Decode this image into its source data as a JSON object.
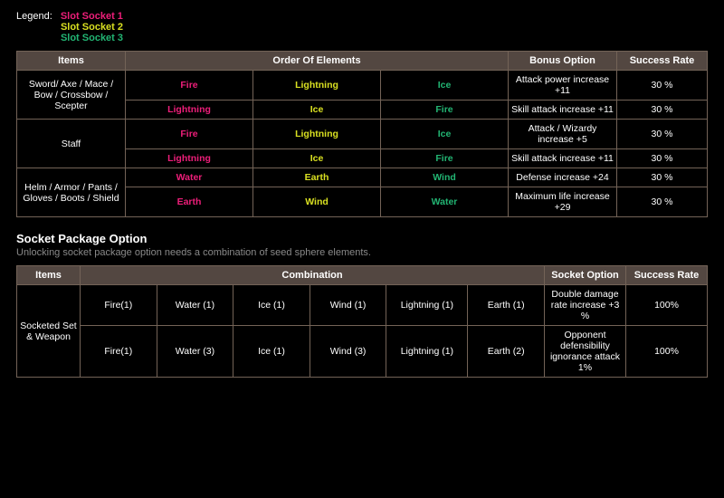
{
  "legend": {
    "label": "Legend:",
    "s1": "Slot Socket 1",
    "s2": "Slot Socket 2",
    "s3": "Slot Socket 3"
  },
  "t1": {
    "h": {
      "items": "Items",
      "order": "Order Of Elements",
      "bonus": "Bonus Option",
      "rate": "Success Rate"
    },
    "g": [
      {
        "item": "Sword/ Axe / Mace / Bow / Crossbow / Scepter",
        "rows": [
          {
            "e1": "Fire",
            "e2": "Lightning",
            "e3": "Ice",
            "bonus": "Attack power increase +11",
            "rate": "30 %"
          },
          {
            "e1": "Lightning",
            "e2": "Ice",
            "e3": "Fire",
            "bonus": "Skill attack increase +11",
            "rate": "30 %"
          }
        ]
      },
      {
        "item": "Staff",
        "rows": [
          {
            "e1": "Fire",
            "e2": "Lightning",
            "e3": "Ice",
            "bonus": "Attack / Wizardy increase +5",
            "rate": "30 %"
          },
          {
            "e1": "Lightning",
            "e2": "Ice",
            "e3": "Fire",
            "bonus": "Skill attack increase +11",
            "rate": "30 %"
          }
        ]
      },
      {
        "item": "Helm / Armor / Pants / Gloves / Boots / Shield",
        "rows": [
          {
            "e1": "Water",
            "e2": "Earth",
            "e3": "Wind",
            "bonus": "Defense increase +24",
            "rate": "30 %"
          },
          {
            "e1": "Earth",
            "e2": "Wind",
            "e3": "Water",
            "bonus": "Maximum life increase +29",
            "rate": "30 %"
          }
        ]
      }
    ]
  },
  "sec": {
    "title": "Socket Package Option",
    "sub": "Unlocking socket package option needs a combination of seed sphere elements."
  },
  "t2": {
    "h": {
      "items": "Items",
      "comb": "Combination",
      "opt": "Socket Option",
      "rate": "Success Rate"
    },
    "item": "Socketed Set & Weapon",
    "rows": [
      {
        "c": [
          "Fire(1)",
          "Water (1)",
          "Ice (1)",
          "Wind (1)",
          "Lightning (1)",
          "Earth (1)"
        ],
        "opt": "Double damage rate increase +3 %",
        "rate": "100%"
      },
      {
        "c": [
          "Fire(1)",
          "Water (3)",
          "Ice (1)",
          "Wind (3)",
          "Lightning (1)",
          "Earth (2)"
        ],
        "opt": "Opponent defensibility ignorance attack 1%",
        "rate": "100%"
      }
    ]
  }
}
